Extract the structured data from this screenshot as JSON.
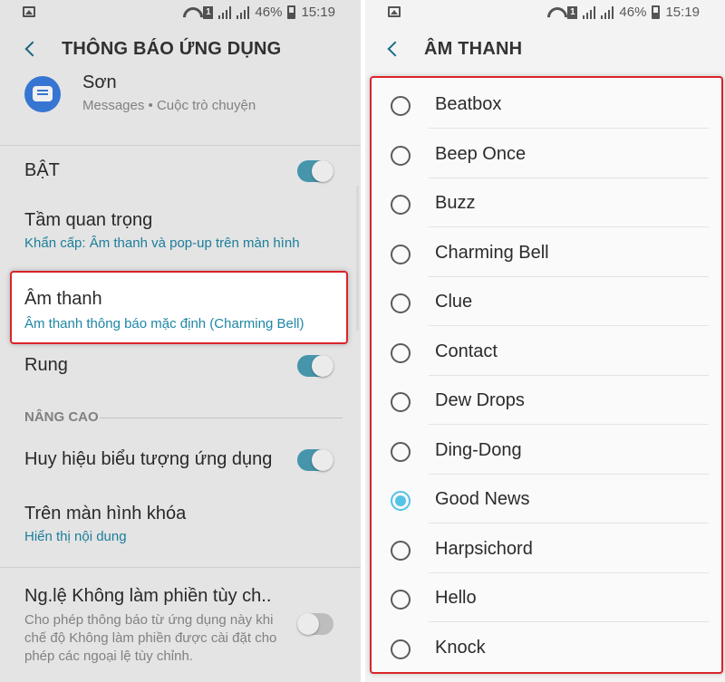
{
  "status": {
    "battery": "46%",
    "time": "15:19",
    "sim": "1"
  },
  "left": {
    "title": "THÔNG BÁO ỨNG DỤNG",
    "app": {
      "name": "Sơn",
      "subtitle": "Messages • Cuộc trò chuyện"
    },
    "toggle_on_label": "BẬT",
    "importance": {
      "label": "Tầm quan trọng",
      "value": "Khẩn cấp: Âm thanh và pop-up trên màn hình"
    },
    "sound": {
      "label": "Âm thanh",
      "value": "Âm thanh thông báo mặc định (Charming Bell)"
    },
    "vibrate_label": "Rung",
    "advanced_label": "NÂNG CAO",
    "badge_label": "Huy hiệu biểu tượng ứng dụng",
    "lock_screen": {
      "label": "Trên màn hình khóa",
      "value": "Hiển thị nội dung"
    },
    "dnd": {
      "label": "Ng.lệ Không làm phiền tùy ch..",
      "value": "Cho phép thông báo từ ứng dụng này khi chế độ Không làm phiền được cài đặt cho phép các ngoại lệ tùy chỉnh."
    }
  },
  "right": {
    "title": "ÂM THANH",
    "selected": "Good News",
    "sounds": [
      "Beatbox",
      "Beep Once",
      "Buzz",
      "Charming Bell",
      "Clue",
      "Contact",
      "Dew Drops",
      "Ding-Dong",
      "Good News",
      "Harpsichord",
      "Hello",
      "Knock"
    ]
  },
  "colors": {
    "accent": "#1e86a5",
    "highlight_border": "#d9252a",
    "radio_on": "#55c3e6",
    "toggle_on": "#4b9fb6"
  },
  "icons": [
    "gallery-icon",
    "wifi-icon",
    "sim-icon",
    "signal-icon",
    "battery-icon",
    "back-arrow-icon",
    "messages-app-icon",
    "radio-icon"
  ]
}
